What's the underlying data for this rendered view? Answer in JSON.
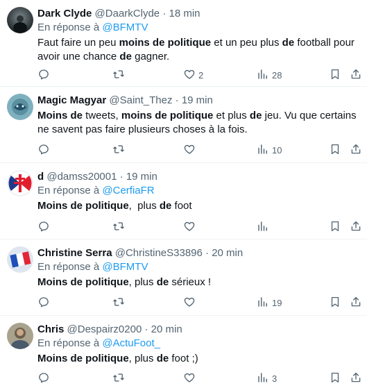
{
  "tweets": [
    {
      "name": "Dark Clyde",
      "handle": "@DaarkClyde",
      "time": "18 min",
      "reply_prefix": "En réponse à",
      "reply_to": "@BFMTV",
      "text_segments": [
        {
          "t": "Faut faire un peu ",
          "b": false
        },
        {
          "t": "moins de politique",
          "b": true
        },
        {
          "t": " et un peu plus ",
          "b": false
        },
        {
          "t": "de",
          "b": true
        },
        {
          "t": " football pour avoir une chance ",
          "b": false
        },
        {
          "t": "de",
          "b": true
        },
        {
          "t": " gagner.",
          "b": false
        }
      ],
      "likes": "2",
      "views": "28"
    },
    {
      "name": "Magic Magyar",
      "handle": "@Saint_Thez",
      "time": "19 min",
      "reply_prefix": "",
      "reply_to": "",
      "text_segments": [
        {
          "t": "Moins de",
          "b": true
        },
        {
          "t": " tweets, ",
          "b": false
        },
        {
          "t": "moins de politique",
          "b": true
        },
        {
          "t": " et plus ",
          "b": false
        },
        {
          "t": "de",
          "b": true
        },
        {
          "t": " jeu. Vu que certains ne savent pas faire plusieurs choses à la fois.",
          "b": false
        }
      ],
      "likes": "",
      "views": "10"
    },
    {
      "name": "d",
      "handle": "@damss20001",
      "time": "19 min",
      "reply_prefix": "En réponse à",
      "reply_to": "@CerfiaFR",
      "text_segments": [
        {
          "t": "Moins de politique",
          "b": true
        },
        {
          "t": ",  plus ",
          "b": false
        },
        {
          "t": "de",
          "b": true
        },
        {
          "t": " foot",
          "b": false
        }
      ],
      "likes": "",
      "views": ""
    },
    {
      "name": "Christine Serra",
      "handle": "@ChristineS33896",
      "time": "20 min",
      "reply_prefix": "En réponse à",
      "reply_to": "@BFMTV",
      "text_segments": [
        {
          "t": "Moins de politique",
          "b": true
        },
        {
          "t": ", plus ",
          "b": false
        },
        {
          "t": "de",
          "b": true
        },
        {
          "t": " sérieux !",
          "b": false
        }
      ],
      "likes": "",
      "views": "19"
    },
    {
      "name": "Chris",
      "handle": "@Despairz0200",
      "time": "20 min",
      "reply_prefix": "En réponse à",
      "reply_to": "@ActuFoot_",
      "text_segments": [
        {
          "t": "Moins de politique",
          "b": true
        },
        {
          "t": ", plus ",
          "b": false
        },
        {
          "t": "de",
          "b": true
        },
        {
          "t": " foot ;)",
          "b": false
        }
      ],
      "likes": "",
      "views": "3"
    }
  ],
  "colors": {
    "text": "#0f1419",
    "secondary": "#536471",
    "link": "#1d9bf0",
    "divider": "#eff3f4"
  }
}
